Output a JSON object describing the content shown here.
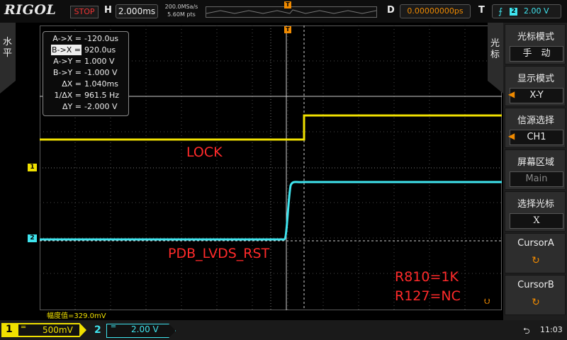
{
  "header": {
    "brand": "RIGOL",
    "run_state": "STOP",
    "h_label": "H",
    "timebase": "2.000ms",
    "sample_rate": "200.0MSa/s",
    "memory_depth": "5.60M pts",
    "d_label": "D",
    "trigger_delay": "0.00000000ps",
    "t_label": "T",
    "trigger_slope_icon": "rising-edge-icon",
    "trigger_source": "2",
    "trigger_level": "2.00 V"
  },
  "left_tab": {
    "label": "水平"
  },
  "cursor_readout": {
    "rows": [
      {
        "key": "A->X =",
        "value": "-120.0us"
      },
      {
        "key": "B->X =",
        "value": "920.0us"
      },
      {
        "key": "A->Y =",
        "value": "1.000 V"
      },
      {
        "key": "B->Y =",
        "value": "-1.000 V"
      },
      {
        "key": "ΔX =",
        "value": "1.040ms"
      },
      {
        "key": "1/ΔX =",
        "value": "961.5 Hz"
      },
      {
        "key": "ΔY =",
        "value": "-2.000 V"
      }
    ]
  },
  "annotations": {
    "lock": "LOCK",
    "pdb": "PDB_LVDS_RST",
    "r810": "R810=1K",
    "r127": "R127=NC"
  },
  "markers": {
    "ch1": "1",
    "ch2": "2",
    "trigger": "T"
  },
  "amplitude_label": "幅度值=329.0mV",
  "menu": {
    "tab_label": "光标",
    "items": [
      {
        "title": "光标模式",
        "value": "手　动"
      },
      {
        "title": "显示模式",
        "value": "X-Y"
      },
      {
        "title": "信源选择",
        "value": "CH1"
      },
      {
        "title": "屏幕区域",
        "value": "Main"
      },
      {
        "title": "选择光标",
        "value": "X"
      },
      {
        "title": "CursorA",
        "value": ""
      },
      {
        "title": "CursorB",
        "value": ""
      }
    ]
  },
  "footer": {
    "ch1_num": "1",
    "ch1_scale": "500mV",
    "ch2_num": "2",
    "ch2_scale": "2.00 V",
    "time": "11:03"
  },
  "colors": {
    "ch1": "#f0e000",
    "ch2": "#3fe4ee",
    "trigger": "#f08a00",
    "annotation": "#ff2a2a"
  }
}
